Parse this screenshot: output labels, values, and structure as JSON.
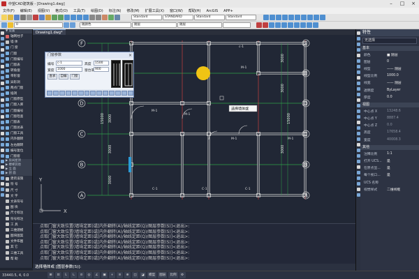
{
  "app": {
    "title": "中望CAD建筑版 - [Drawing1.dwg]"
  },
  "menu": [
    "文件(F)",
    "编辑(E)",
    "视图(V)",
    "格式(O)",
    "工具(T)",
    "绘图(D)",
    "标注(N)",
    "修改(M)",
    "扩展工具(X)",
    "窗口(W)",
    "帮助(H)",
    "ArcGIS",
    "APP+"
  ],
  "toolbar": {
    "dd1": "Standard",
    "dd2": "STANDARD",
    "dd3": "Standard",
    "dd4": "Standard",
    "layer": "0",
    "linetype1": "随层",
    "linetype2": "随层",
    "color": "随颜色"
  },
  "doc": {
    "tab": "Drawing1.dwg*"
  },
  "sidebar": [
    {
      "type": "sec",
      "label": "▼ 设置"
    },
    {
      "type": "item",
      "label": "轴网柱子",
      "color": "#d66"
    },
    {
      "type": "item",
      "label": "墙 体",
      "color": "#c8c8c8"
    },
    {
      "type": "item",
      "label": "门 窗",
      "color": "#7ab0e0"
    },
    {
      "type": "item",
      "label": "门窗",
      "color": "#7ab0e0"
    },
    {
      "type": "item",
      "label": "门窗编号",
      "color": "#7ab0e0"
    },
    {
      "type": "item",
      "label": "门窗表",
      "color": "#7ab0e0"
    },
    {
      "type": "item",
      "label": "转角窗",
      "color": "#7ab0e0"
    },
    {
      "type": "item",
      "label": "带形窗",
      "color": "#7ab0e0"
    },
    {
      "type": "item",
      "label": "异形洞",
      "color": "#7ab0e0"
    },
    {
      "type": "item",
      "label": "两点门窗",
      "color": "#7ab0e0"
    },
    {
      "type": "item",
      "label": "插洞",
      "color": "#7ab0e0"
    },
    {
      "type": "item",
      "label": "门窗原型",
      "color": "#7ab0e0"
    },
    {
      "type": "item",
      "label": "门窗入库",
      "color": "#7ab0e0"
    },
    {
      "type": "item",
      "label": "门窗编号",
      "color": "#7ab0e0"
    },
    {
      "type": "item",
      "label": "门窗检查",
      "color": "#7ab0e0"
    },
    {
      "type": "item",
      "label": "门窗表",
      "color": "#7ab0e0"
    },
    {
      "type": "item",
      "label": "门窗总表",
      "color": "#7ab0e0"
    },
    {
      "type": "item",
      "label": "门窗工具",
      "color": "#7ab0e0"
    },
    {
      "type": "item",
      "label": "内外翻转",
      "color": "#7ab0e0"
    },
    {
      "type": "item",
      "label": "左右翻转",
      "color": "#7ab0e0"
    },
    {
      "type": "item",
      "label": "编号复位",
      "color": "#7ab0e0"
    },
    {
      "type": "item",
      "label": "门窗套",
      "color": "#7ab0e0"
    },
    {
      "type": "sec",
      "label": "▶ 房间屋顶"
    },
    {
      "type": "sec",
      "label": "▶ 楼梯其他"
    },
    {
      "type": "sec",
      "label": "▶ 立 面"
    },
    {
      "type": "sec",
      "label": "▶ 剖 面"
    },
    {
      "type": "item",
      "label": "建筑设施",
      "color": "#c8c8c8"
    },
    {
      "type": "item",
      "label": "符 号",
      "color": "#c8c8c8"
    },
    {
      "type": "item",
      "label": "尺 寸",
      "color": "#c8c8c8"
    },
    {
      "type": "item",
      "label": "文 字",
      "color": "#c8c8c8"
    },
    {
      "type": "item",
      "label": "文表符号",
      "color": "#c8c8c8"
    },
    {
      "type": "item",
      "label": "图 块",
      "color": "#c8c8c8"
    },
    {
      "type": "item",
      "label": "尺寸标注",
      "color": "#c8c8c8"
    },
    {
      "type": "item",
      "label": "符号标注",
      "color": "#c8c8c8"
    },
    {
      "type": "item",
      "label": "工 具",
      "color": "#c8c8c8"
    },
    {
      "type": "item",
      "label": "三维建模",
      "color": "#c8c8c8"
    },
    {
      "type": "item",
      "label": "图块图案",
      "color": "#c8c8c8"
    },
    {
      "type": "item",
      "label": "文件布图",
      "color": "#c8c8c8"
    },
    {
      "type": "item",
      "label": "其 它",
      "color": "#c8c8c8"
    },
    {
      "type": "item",
      "label": "三维工具",
      "color": "#c8c8c8"
    },
    {
      "type": "item",
      "label": "帮 助",
      "color": "#c8c8c8"
    }
  ],
  "drawing": {
    "row_axes": [
      "F",
      "E",
      "D",
      "C",
      "B",
      "A"
    ],
    "col_axes": [
      "1",
      "2",
      "3",
      "4",
      "5"
    ],
    "dims_left": [
      "3000",
      "3000",
      "3000",
      "3000"
    ],
    "dims_right": [
      "3000",
      "3000",
      "3000"
    ],
    "dim_total_left": "15000",
    "dim_total_right": "15000",
    "door_labels": [
      "c-1",
      "M-1",
      "M-1",
      "M-1",
      "M-1",
      "C-1",
      "C-1",
      "C-1",
      "M-1"
    ],
    "tooltip": "选择墙体或",
    "ucs": {
      "x": "X",
      "y": "Y"
    }
  },
  "dialog": {
    "title": "门窗参数",
    "fields": [
      {
        "label": "编号",
        "value": "c-1"
      },
      {
        "label": "宽度",
        "value": "1000"
      },
      {
        "label": "高度",
        "value": "1500"
      },
      {
        "label": "窗台高",
        "value": "900"
      }
    ],
    "buttons": [
      "查表",
      "自编",
      "门窗"
    ]
  },
  "command": {
    "lines": [
      "点取门窗大致位置(墙垛定距)或[内外翻转(A)/轴线定距(Q)/图层参数(S)]<退出>:",
      "点取门窗大致位置(墙垛定距)或[内外翻转(A)/轴线定距(Q)/图层参数(S)]<退出>:",
      "点取门窗大致位置(墙垛定距)或[内外翻转(A)/轴线定距(Q)/图层参数(S)]<退出>:",
      "点取门窗大致位置(墙垛定距)或[内外翻转(A)/轴线定距(Q)/图层参数(S)]<退出>:",
      "点取门窗大致位置(墙垛定距)或[内外翻转(A)/轴线定距(Q)/图层参数(S)]<退出>:",
      "点取门窗大致位置(墙垛定距)或[内外翻转(A)/轴线定距(Q)/图层参数(S)]<退出>:",
      "点取门窗大致位置(墙垛定距)或[内外翻转(A)/轴线定距(Q)/图层参数(S)]<退出>:"
    ],
    "prompt": "选择墙体或 [图层参数(S)]:"
  },
  "status": {
    "coord": "33440.5, 4, 0.0",
    "buttons": [
      "⊞",
      "⊡",
      "L",
      "∟",
      "⊙",
      "◎",
      "∠",
      "▣",
      "+",
      "≡",
      "⊕",
      "◫",
      "◪",
      "模型",
      "图层",
      "比例",
      "⚙"
    ]
  },
  "properties": {
    "title": "特性",
    "selection": "无选择",
    "groups": [
      {
        "name": "基本",
        "rows": [
          {
            "k": "颜色",
            "v": "■ 随层"
          },
          {
            "k": "图层",
            "v": "0"
          },
          {
            "k": "线型",
            "v": "—— 随层"
          },
          {
            "k": "线型比例",
            "v": "1000.0"
          },
          {
            "k": "线宽",
            "v": "—— 随层"
          },
          {
            "k": "透明度",
            "v": "ByLayer"
          },
          {
            "k": "厚度",
            "v": "0.0"
          }
        ]
      },
      {
        "name": "视图",
        "rows": [
          {
            "k": "中心点 X",
            "v": "13248.6",
            "dim": true
          },
          {
            "k": "中心点 Y",
            "v": "8887.4",
            "dim": true
          },
          {
            "k": "中心点 Z",
            "v": "0.0",
            "dim": true
          },
          {
            "k": "高度",
            "v": "17658.4",
            "dim": true
          },
          {
            "k": "宽度",
            "v": "40008.3",
            "dim": true
          }
        ]
      },
      {
        "name": "其他",
        "rows": [
          {
            "k": "注释比例",
            "v": "1:1"
          },
          {
            "k": "打开 UCS...",
            "v": "是"
          },
          {
            "k": "在原点显...",
            "v": "是"
          },
          {
            "k": "每个视口...",
            "v": "是"
          },
          {
            "k": "UCS 名称",
            "v": ""
          },
          {
            "k": "视觉样式",
            "v": "二维线框"
          }
        ]
      }
    ]
  }
}
